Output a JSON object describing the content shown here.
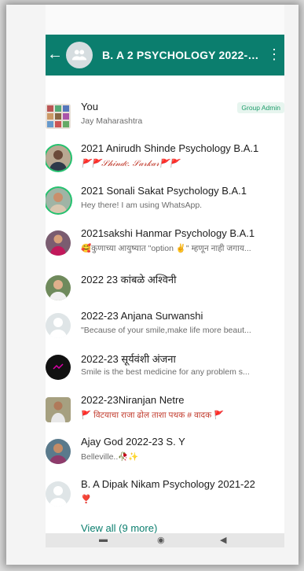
{
  "header": {
    "back_icon": "arrow-left",
    "group_avatar_icon": "group-icon",
    "title": "B. A 2 PSYCHOLOGY 2022-…",
    "more_icon": "more-vertical"
  },
  "colors": {
    "appbar": "#0b7e6e",
    "admin_badge_text": "#1f9d6b",
    "status_ring": "#25c16f",
    "link": "#0b7e6e"
  },
  "members": [
    {
      "name": "You",
      "status": "Jay Maharashtra",
      "badge": "Group Admin"
    },
    {
      "name": "2021 Anirudh Shinde Psychology B.A.1",
      "status": "🚩🚩𝒮𝒽𝒾𝓃𝒹𝑒. 𝒮𝒶𝓇𝓀𝒶𝓇🚩🚩"
    },
    {
      "name": "2021 Sonali Sakat Psychology B.A.1",
      "status": "Hey there! I am using WhatsApp."
    },
    {
      "name": "2021sakshi Hanmar Psychology B.A.1",
      "status": "🥰कुणाच्या आयुष्यात \"option ✌️\" म्हणून नाही जगाय..."
    },
    {
      "name": "2022 23 कांबळे अश्विनी",
      "status": ""
    },
    {
      "name": "2022-23 Anjana Surwanshi",
      "status": "\"Because of your smile,make life more beaut..."
    },
    {
      "name": "2022-23 सूर्यवंशी अंजना",
      "status": "Smile is the best medicine for any problem s..."
    },
    {
      "name": "2022-23Niranjan Netre",
      "status": "🚩 विटयाचा राजा ढोल ताशा पथक # वादक 🚩"
    },
    {
      "name": "Ajay God 2022-23 S. Y",
      "status": "Belleville..🥀✨"
    },
    {
      "name": "B. A Dipak Nikam Psychology 2021-22",
      "status": "❣️"
    }
  ],
  "view_all": "View all (9 more)",
  "nav": {
    "back": "◀",
    "home": "◉",
    "recents": "▬"
  }
}
